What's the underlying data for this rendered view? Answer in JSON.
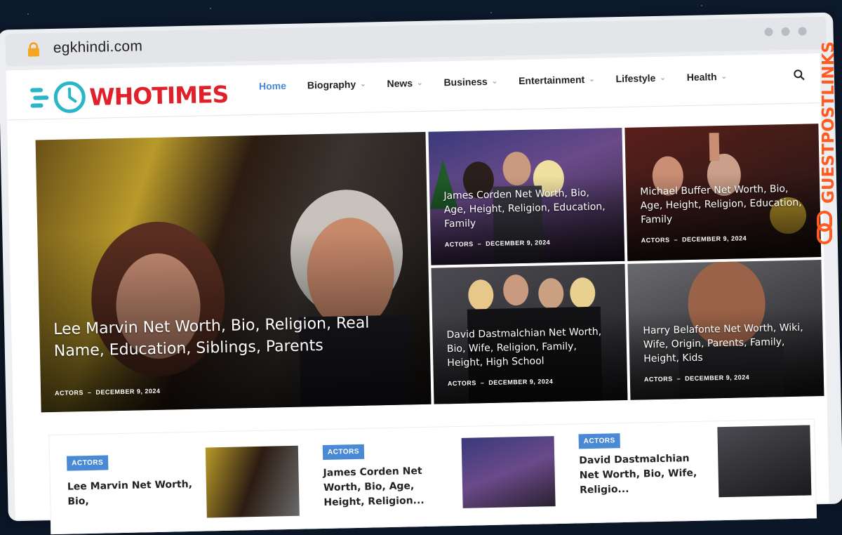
{
  "browser": {
    "url": "egkhindi.com"
  },
  "site": {
    "logo_text": "WHOTIMES"
  },
  "nav": [
    {
      "label": "Home"
    },
    {
      "label": "Biography"
    },
    {
      "label": "News"
    },
    {
      "label": "Business"
    },
    {
      "label": "Entertainment"
    },
    {
      "label": "Lifestyle"
    },
    {
      "label": "Health"
    }
  ],
  "featured": [
    {
      "title": "Lee Marvin Net Worth, Bio, Religion, Real Name, Education, Siblings, Parents",
      "category": "ACTORS",
      "date": "DECEMBER 9, 2024"
    },
    {
      "title": "James Corden Net Worth, Bio, Age, Height, Religion, Education, Family",
      "category": "ACTORS",
      "date": "DECEMBER 9, 2024"
    },
    {
      "title": "Michael Buffer Net Worth, Bio, Age, Height, Religion, Education, Family",
      "category": "ACTORS",
      "date": "DECEMBER 9, 2024"
    },
    {
      "title": "David Dastmalchian Net Worth, Bio, Wife, Religion, Family, Height, High School",
      "category": "ACTORS",
      "date": "DECEMBER 9, 2024"
    },
    {
      "title": "Harry Belafonte Net Worth, Wiki, Wife, Origin, Parents, Family, Height, Kids",
      "category": "ACTORS",
      "date": "DECEMBER 9, 2024"
    }
  ],
  "cards": [
    {
      "badge": "ACTORS",
      "title": "Lee Marvin Net Worth, Bio,"
    },
    {
      "badge": "ACTORS",
      "title": "James Corden Net Worth, Bio, Age, Height, Religion..."
    },
    {
      "badge": "ACTORS",
      "title": "David Dastmalchian Net Worth, Bio, Wife, Religio..."
    }
  ],
  "watermark": "GUESTPOSTLINKS",
  "colors": {
    "accent": "#4a8ad4",
    "brand": "#e0212b",
    "watermark": "#ff5a1f"
  }
}
